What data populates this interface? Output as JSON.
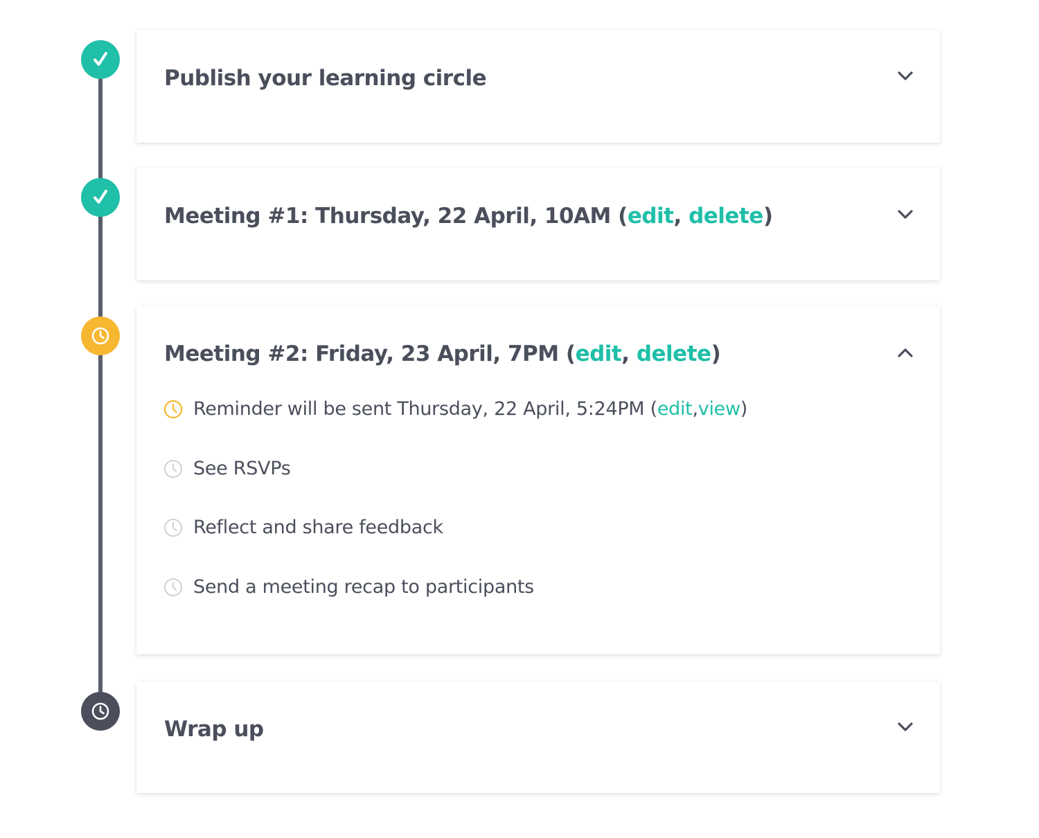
{
  "colors": {
    "accent": "#1fbfa8",
    "pending": "#f7b731",
    "upcoming": "#4b4f5c",
    "timeline": "#5a5e6b",
    "muted_icon": "#d0d2d6"
  },
  "steps": [
    {
      "status": "done",
      "icon": "check-icon",
      "title": "Publish your learning circle",
      "expanded": false
    },
    {
      "status": "done",
      "icon": "check-icon",
      "title_prefix": "Meeting #1: Thursday, 22 April, 10AM (",
      "edit_label": "edit",
      "separator": ", ",
      "delete_label": "delete",
      "title_suffix": ")",
      "expanded": false
    },
    {
      "status": "current",
      "icon": "clock-icon",
      "title_prefix": "Meeting #2: Friday, 23 April, 7PM (",
      "edit_label": "edit",
      "separator": ", ",
      "delete_label": "delete",
      "title_suffix": ")",
      "expanded": true,
      "tasks": [
        {
          "status": "pending",
          "icon": "clock-icon",
          "text_prefix": "Reminder will be sent Thursday, 22 April, 5:24PM (",
          "edit_label": "edit",
          "separator": ", ",
          "view_label": "view",
          "text_suffix": ")"
        },
        {
          "status": "upcoming",
          "icon": "clock-icon",
          "text": "See RSVPs"
        },
        {
          "status": "upcoming",
          "icon": "clock-icon",
          "text": "Reflect and share feedback"
        },
        {
          "status": "upcoming",
          "icon": "clock-icon",
          "text": "Send a meeting recap to participants"
        }
      ]
    },
    {
      "status": "upcoming",
      "icon": "clock-icon",
      "title": "Wrap up",
      "expanded": false
    }
  ]
}
